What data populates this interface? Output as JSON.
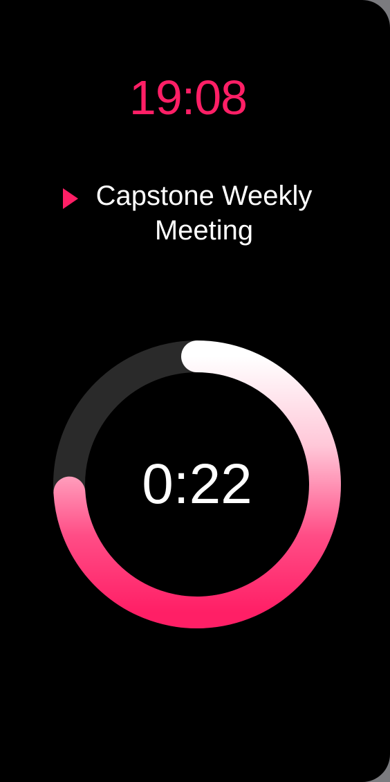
{
  "clock": "19:08",
  "event": {
    "icon": "play-icon",
    "title": "Capstone Weekly Meeting"
  },
  "timer": {
    "remaining": "0:22",
    "progress_fraction": 0.74
  },
  "colors": {
    "accent": "#ff1f66",
    "track": "#2a2a2a",
    "background": "#000000",
    "text": "#ffffff"
  }
}
